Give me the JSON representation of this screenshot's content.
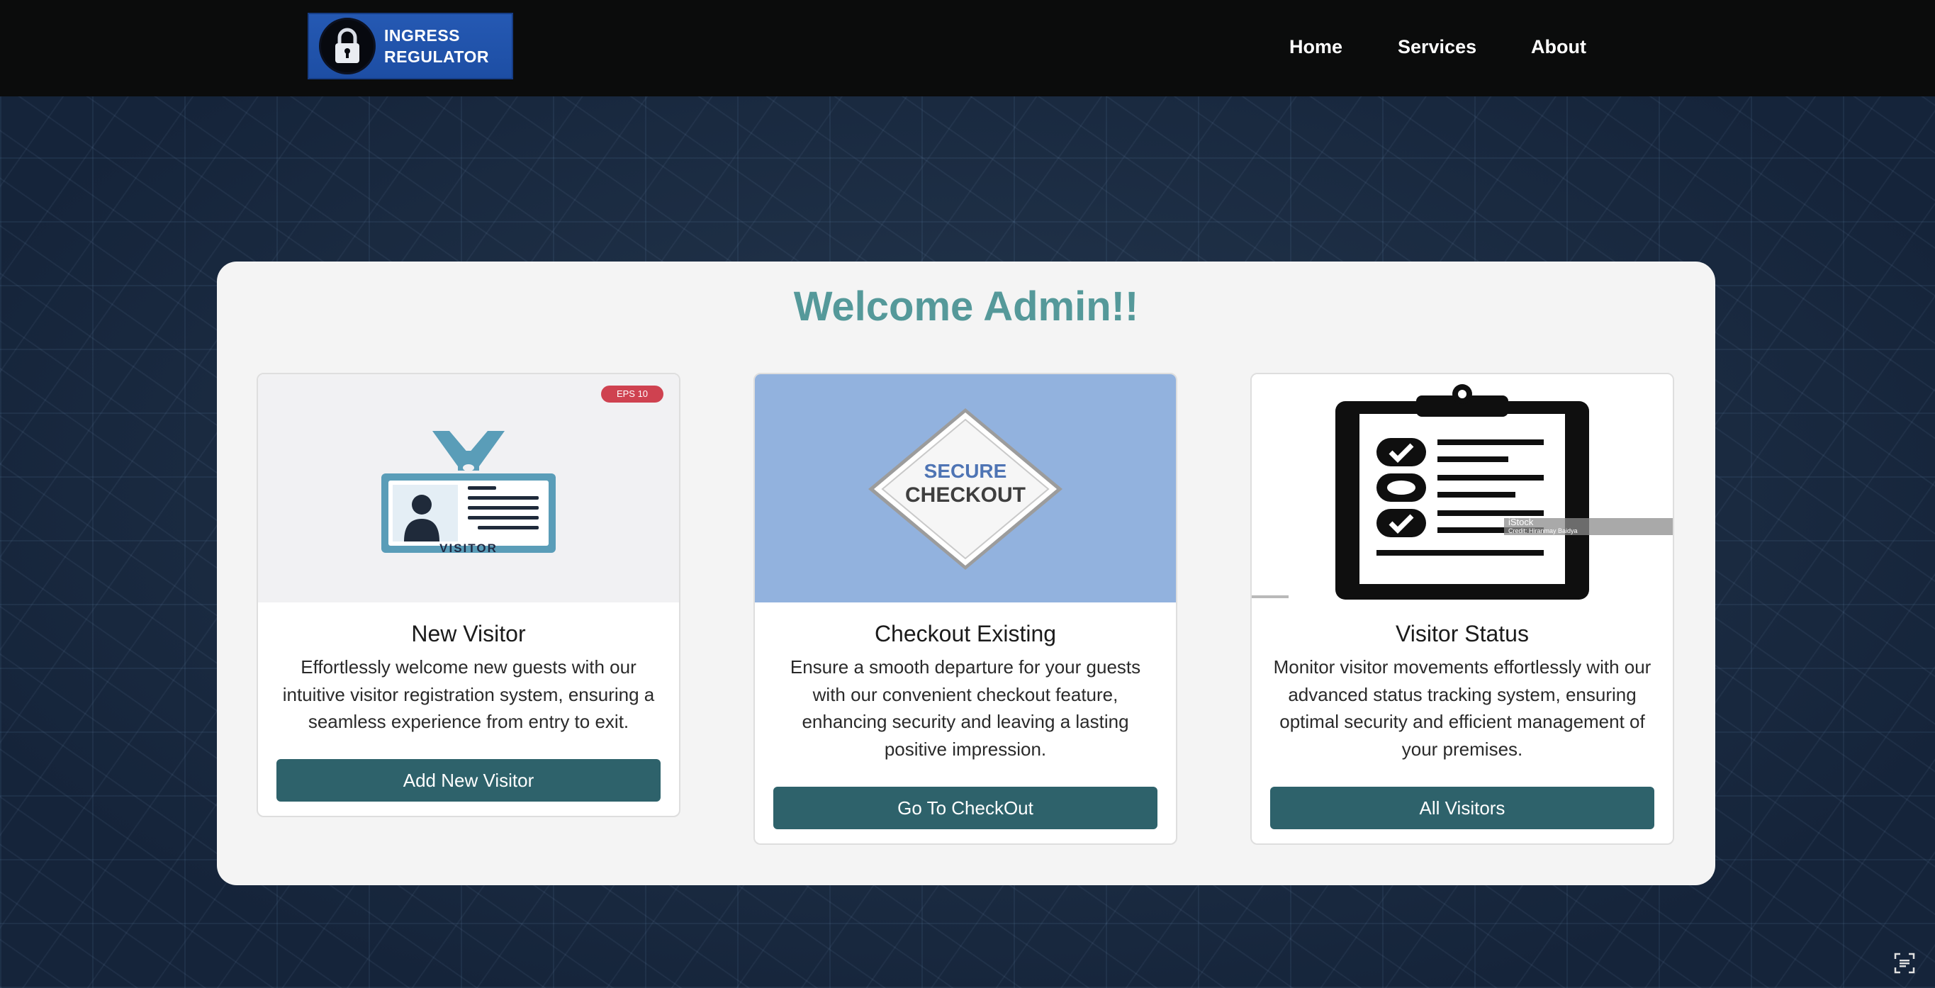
{
  "navbar": {
    "logo_line1": "INGRESS",
    "logo_line2": "REGULATOR",
    "links": [
      {
        "label": "Home"
      },
      {
        "label": "Services"
      },
      {
        "label": "About"
      }
    ]
  },
  "main": {
    "welcome": "Welcome Admin!!",
    "cards": [
      {
        "title": "New Visitor",
        "description": "Effortlessly welcome new guests with our intuitive visitor registration system, ensuring a seamless experience from entry to exit.",
        "button": "Add New Visitor",
        "image_badge": "EPS 10",
        "image_caption": "VISITOR",
        "icon": "visitor-badge-icon"
      },
      {
        "title": "Checkout Existing",
        "description": "Ensure a smooth departure for your guests with our convenient checkout feature, enhancing security and leaving a lasting positive impression.",
        "button": "Go To CheckOut",
        "image_line1": "SECURE",
        "image_line2": "CHECKOUT",
        "icon": "secure-checkout-sign-icon"
      },
      {
        "title": "Visitor Status",
        "description": "Monitor visitor movements effortlessly with our advanced status tracking system, ensuring optimal security and efficient management of your premises.",
        "button": "All Visitors",
        "image_watermark": "iStock",
        "image_credit": "Credit: Hiranmay Baidya",
        "icon": "clipboard-checklist-icon"
      }
    ]
  },
  "colors": {
    "navbar_bg": "#0b0c0c",
    "logo_bg": "#1d4ea4",
    "welcome_text": "#55999a",
    "button_bg": "#2e626b",
    "panel_bg": "#f4f4f4",
    "checkout_image_bg": "#92b2de"
  }
}
